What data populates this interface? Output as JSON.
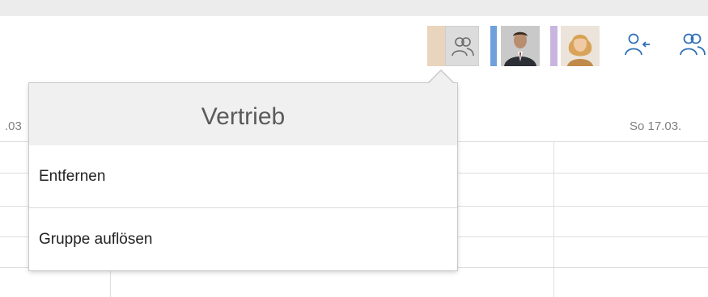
{
  "toolbar": {
    "items": [
      {
        "type": "group",
        "icon": "group-icon",
        "color": "#e9d5bd"
      },
      {
        "type": "person",
        "icon": "avatar-man",
        "color": "#6ea0dc"
      },
      {
        "type": "person",
        "icon": "avatar-woman",
        "color": "#c8b6df"
      },
      {
        "type": "action",
        "icon": "person-arrow-icon"
      },
      {
        "type": "action",
        "icon": "group-icon"
      }
    ]
  },
  "calendar": {
    "day_left": ".03",
    "day_right": "So 17.03."
  },
  "popover": {
    "title": "Vertrieb",
    "menu": [
      {
        "label": "Entfernen"
      },
      {
        "label": "Gruppe auflösen"
      }
    ]
  }
}
